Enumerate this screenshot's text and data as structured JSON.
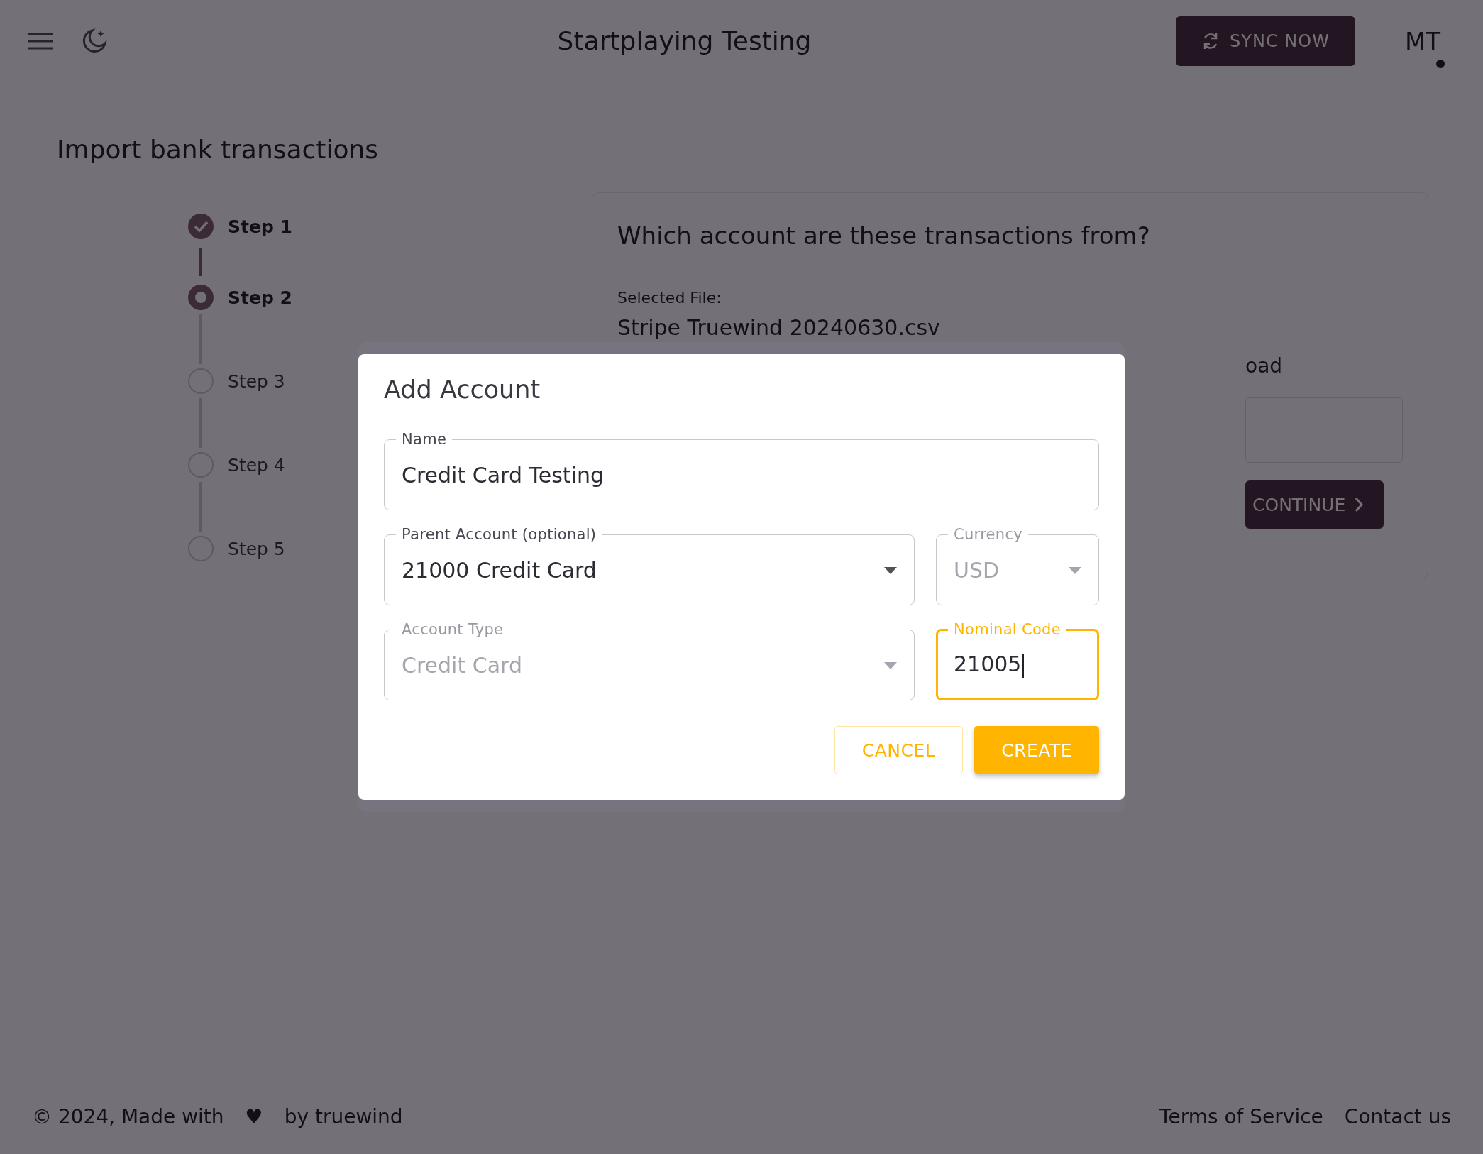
{
  "header": {
    "title": "Startplaying Testing",
    "sync_button": "SYNC NOW",
    "avatar": "MT"
  },
  "card": {
    "title": "Import bank transactions",
    "steps": [
      {
        "label": "Step 1",
        "kind": "done"
      },
      {
        "label": "Step 2",
        "kind": "active"
      },
      {
        "label": "Step 3",
        "kind": "pending"
      },
      {
        "label": "Step 4",
        "kind": "pending"
      },
      {
        "label": "Step 5",
        "kind": "pending"
      }
    ],
    "panel": {
      "question": "Which account are these transactions from?",
      "file_label": "Selected File:",
      "file_name": "Stripe Truewind 20240630.csv",
      "partial_label": "oad",
      "continue_button": "CONTINUE"
    }
  },
  "dialog": {
    "title": "Add Account",
    "fields": [
      {
        "label": "Name",
        "value": "Credit Card Testing",
        "kind": "text",
        "disabled": false,
        "focused": false
      },
      {
        "label": "Parent Account (optional)",
        "value": "21000 Credit Card",
        "kind": "select",
        "disabled": false,
        "focused": false
      },
      {
        "label": "Currency",
        "value": "USD",
        "kind": "select",
        "disabled": true,
        "focused": false
      },
      {
        "label": "Account Type",
        "value": "Credit Card",
        "kind": "select",
        "disabled": true,
        "focused": false
      },
      {
        "label": "Nominal Code",
        "value": "21005",
        "kind": "text",
        "disabled": false,
        "focused": true
      }
    ],
    "buttons": [
      {
        "label": "CANCEL",
        "kind": "outlined"
      },
      {
        "label": "CREATE",
        "kind": "contained"
      }
    ]
  },
  "footer": {
    "copyright": "© 2024, Made with",
    "heart": "♥",
    "by": "by truewind",
    "links": [
      "Terms of Service",
      "Contact us"
    ]
  }
}
